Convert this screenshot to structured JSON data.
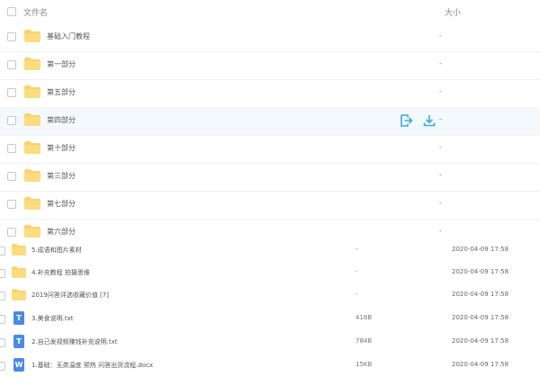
{
  "header": {
    "col_name": "文件名",
    "col_size": "大小"
  },
  "colors": {
    "folder": "#f8d36a",
    "accent": "#3ba9d9",
    "txt_icon": "#4a8ae3",
    "docx_icon": "#4a8ae3"
  },
  "folders": [
    {
      "name": "基础入门教程",
      "size": "-"
    },
    {
      "name": "第一部分",
      "size": "-"
    },
    {
      "name": "第五部分",
      "size": "-"
    },
    {
      "name": "第四部分",
      "size": "-",
      "hover": true
    },
    {
      "name": "第十部分",
      "size": "-"
    },
    {
      "name": "第三部分",
      "size": "-"
    },
    {
      "name": "第七部分",
      "size": "-"
    },
    {
      "name": "第六部分",
      "size": "-"
    }
  ],
  "hover_actions": {
    "share_icon": "share-icon",
    "download_icon": "download-icon"
  },
  "files": [
    {
      "type": "folder",
      "name": "5.成语和图片素材",
      "size": "-",
      "date": "2020-04-09 17:58"
    },
    {
      "type": "folder",
      "name": "4.补充教程 拍摄思维",
      "size": "-",
      "date": "2020-04-09 17:58"
    },
    {
      "type": "folder",
      "name": "2019问答评选收藏价值 [7]",
      "size": "-",
      "date": "2020-04-09 17:58"
    },
    {
      "type": "txt",
      "icon_letter": "T",
      "name": "3.美食说明.txt",
      "size": "418B",
      "date": "2020-04-09 17:58"
    },
    {
      "type": "txt",
      "icon_letter": "T",
      "name": "2.自己发视频赚钱补充说明.txt",
      "size": "784B",
      "date": "2020-04-09 17:58"
    },
    {
      "type": "docx",
      "icon_letter": "W",
      "name": "1.基础：无类温度 预热 问答出货流程.docx",
      "size": "15KB",
      "date": "2020-04-09 17:58"
    }
  ]
}
